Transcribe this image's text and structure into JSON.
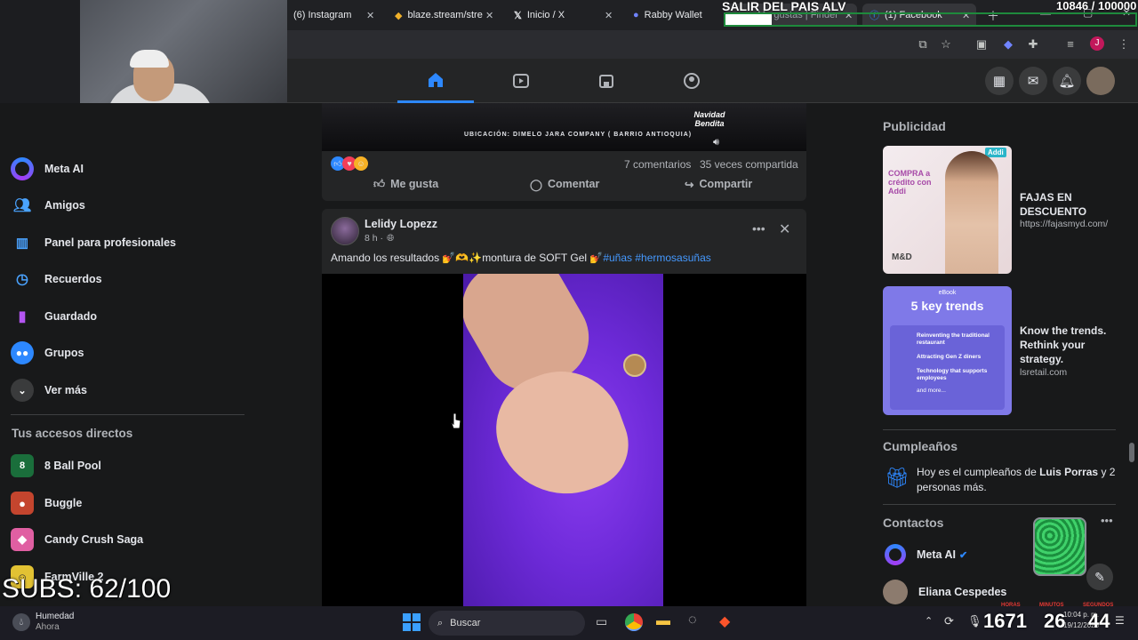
{
  "browser": {
    "tabs": [
      {
        "label": "(6) Instagram"
      },
      {
        "label": "blaze.stream/stre"
      },
      {
        "label": "Inicio / X"
      },
      {
        "label": "Rabby Wallet"
      },
      {
        "label": "Me gustas | Finder"
      },
      {
        "label": "(1) Facebook"
      }
    ]
  },
  "overlay": {
    "stream_title": "SALIR DEL PAIS ALV",
    "counter": "10846 / 100000",
    "subs": "SUBS: 62/100",
    "timer_labels": [
      "HORAS",
      "MINUTOS",
      "SEGUNDOS"
    ],
    "timer_values": [
      "1671",
      "26",
      "44"
    ]
  },
  "sidebar": {
    "items": [
      {
        "label": "Meta AI"
      },
      {
        "label": "Amigos"
      },
      {
        "label": "Panel para profesionales"
      },
      {
        "label": "Recuerdos"
      },
      {
        "label": "Guardado"
      },
      {
        "label": "Grupos"
      },
      {
        "label": "Ver más"
      }
    ],
    "shortcuts_title": "Tus accesos directos",
    "shortcuts": [
      {
        "label": "8 Ball Pool"
      },
      {
        "label": "Buggle"
      },
      {
        "label": "Candy Crush Saga"
      },
      {
        "label": "FarmVille 2"
      }
    ]
  },
  "prev_post": {
    "banner_text": "UBICACIÓN: DIMELO JARA COMPANY ( BARRIO ANTIOQUIA)",
    "banner_logo": "Navidad Bendita",
    "comments": "7 comentarios",
    "shares": "35 veces compartida",
    "actions": {
      "like": "Me gusta",
      "comment": "Comentar",
      "share": "Compartir"
    }
  },
  "post": {
    "author": "Lelidy Lopezz",
    "time": "8 h ·",
    "text_prefix": "Amando los resultados 💅🫶✨montura de SOFT Gel 💅",
    "hashtags": "#uñas #hermosasuñas"
  },
  "right": {
    "ads_title": "Publicidad",
    "ads": [
      {
        "title": "FAJAS EN DESCUENTO",
        "url": "https://fajasmyd.com/",
        "image_text": "COMPRA a crédito con Addi",
        "brand": "Addi",
        "logo": "M&D"
      },
      {
        "title": "Know the trends. Rethink your strategy.",
        "url": "lsretail.com",
        "image_text": "5 key trends",
        "ebook": "eBook",
        "bullets": [
          "Reinventing the traditional restaurant",
          "Attracting Gen Z diners",
          "Technology that supports employees",
          "and more..."
        ]
      }
    ],
    "birthdays_title": "Cumpleaños",
    "birthday_prefix": "Hoy es el cumpleaños de ",
    "birthday_name": "Luis Porras",
    "birthday_suffix": " y 2 personas más.",
    "contacts_title": "Contactos",
    "contacts": [
      {
        "name": "Meta AI"
      },
      {
        "name": "Eliana Cespedes"
      }
    ]
  },
  "taskbar": {
    "weather_title": "Humedad",
    "weather_sub": "Ahora",
    "search": "Buscar",
    "time": "10:04 p. m.",
    "date": "19/12/2025"
  },
  "colors": {
    "accent": "#2d88ff",
    "bg": "#18191a",
    "card": "#242526",
    "overlay_green": "#1e8a3c"
  }
}
